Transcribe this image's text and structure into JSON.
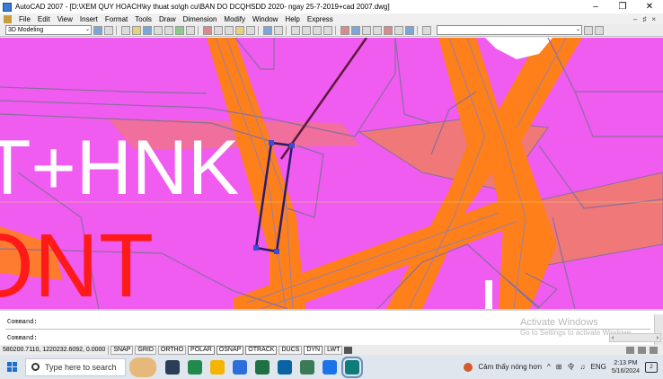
{
  "window": {
    "title": "AutoCAD 2007 - [D:\\XEM QUY HOACH\\ky thuat so\\gh cu\\BAN DO DCQHSDD 2020- ngay 25-7-2019+cad 2007.dwg]",
    "minimize": "–",
    "maximize": "❐",
    "close": "✕"
  },
  "menu": {
    "items": [
      "File",
      "Edit",
      "View",
      "Insert",
      "Format",
      "Tools",
      "Draw",
      "Dimension",
      "Modify",
      "Window",
      "Help",
      "Express"
    ],
    "mdi_controls": [
      "–",
      "♯",
      "×"
    ]
  },
  "toolbar": {
    "workspace": "3D Modeling",
    "dropdown_arrow": "⌄"
  },
  "drawing": {
    "texts": [
      "T+HNK",
      "ONT"
    ],
    "colors": {
      "background": "#f05bf0",
      "road": "#ff7f1a",
      "boundary": "#8a6e9e",
      "white_text": "#ffffff",
      "red_text": "#ff1a1a",
      "selection": "#2b1b6b",
      "salmon": "#f07878"
    }
  },
  "command": {
    "line1": "Command:",
    "line2": "Command:"
  },
  "watermark": {
    "title": "Activate Windows",
    "subtitle": "Go to Settings to activate Windows."
  },
  "status": {
    "coords": "580200.7110, 1220232.6092, 0.0000",
    "buttons": [
      "SNAP",
      "GRID",
      "ORTHO",
      "POLAR",
      "OSNAP",
      "OTRACK",
      "DUCS",
      "DYN",
      "LWT"
    ],
    "active_buttons": [
      "POLAR",
      "OSNAP",
      "OTRACK",
      "DYN"
    ]
  },
  "taskbar": {
    "search_placeholder": "Type here to search",
    "weather": "Cảm thấy nóng hơn",
    "tray_icons": [
      "^",
      "⊞",
      "令",
      "♫",
      "ENG"
    ],
    "time": "2:13 PM",
    "date": "5/16/2024",
    "notifications": "2",
    "app_colors": [
      "#2b3e57",
      "#1f8a4c",
      "#2a6fdb",
      "#f4b400",
      "#1e7145",
      "#0a64a4",
      "#3b7a57",
      "#1a73e8",
      "#0e7d7a"
    ]
  }
}
